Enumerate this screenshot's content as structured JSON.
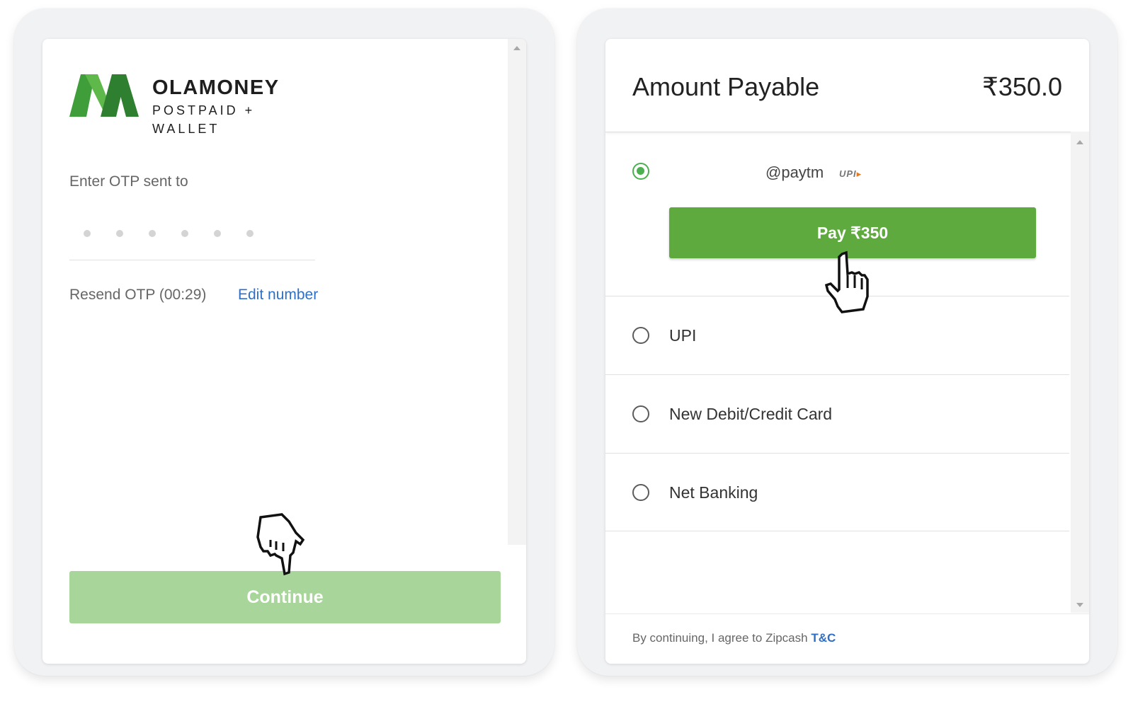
{
  "left_panel": {
    "brand_name": "OLAMONEY",
    "brand_sub": "POSTPAID + WALLET",
    "otp_label": "Enter OTP sent to",
    "resend_text": "Resend OTP (00:29)",
    "edit_number": "Edit number",
    "continue_label": "Continue"
  },
  "right_panel": {
    "amount_title": "Amount Payable",
    "amount_value": "₹350.0",
    "options": [
      {
        "label": "@paytm",
        "badge": "UPI",
        "selected": true
      },
      {
        "label": "UPI",
        "selected": false
      },
      {
        "label": "New Debit/Credit Card",
        "selected": false
      },
      {
        "label": "Net Banking",
        "selected": false
      }
    ],
    "pay_label": "Pay ₹350",
    "footer_text": "By continuing, I agree to Zipcash",
    "footer_link": "T&C"
  },
  "colors": {
    "green_primary": "#5faa3e",
    "green_disabled": "#a8d59a",
    "link_blue": "#2f6fc6"
  },
  "icons": [
    "olamoney-logo",
    "hand-pointer-icon",
    "upi-logo",
    "radio-icon"
  ]
}
